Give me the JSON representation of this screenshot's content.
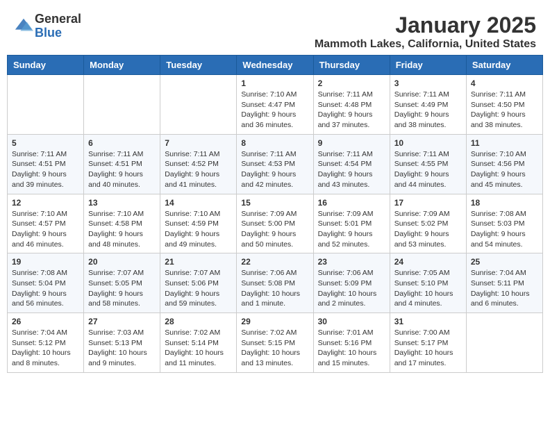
{
  "header": {
    "logo_general": "General",
    "logo_blue": "Blue",
    "month_title": "January 2025",
    "location": "Mammoth Lakes, California, United States"
  },
  "days_of_week": [
    "Sunday",
    "Monday",
    "Tuesday",
    "Wednesday",
    "Thursday",
    "Friday",
    "Saturday"
  ],
  "weeks": [
    [
      {
        "day": "",
        "content": ""
      },
      {
        "day": "",
        "content": ""
      },
      {
        "day": "",
        "content": ""
      },
      {
        "day": "1",
        "content": "Sunrise: 7:10 AM\nSunset: 4:47 PM\nDaylight: 9 hours and 36 minutes."
      },
      {
        "day": "2",
        "content": "Sunrise: 7:11 AM\nSunset: 4:48 PM\nDaylight: 9 hours and 37 minutes."
      },
      {
        "day": "3",
        "content": "Sunrise: 7:11 AM\nSunset: 4:49 PM\nDaylight: 9 hours and 38 minutes."
      },
      {
        "day": "4",
        "content": "Sunrise: 7:11 AM\nSunset: 4:50 PM\nDaylight: 9 hours and 38 minutes."
      }
    ],
    [
      {
        "day": "5",
        "content": "Sunrise: 7:11 AM\nSunset: 4:51 PM\nDaylight: 9 hours and 39 minutes."
      },
      {
        "day": "6",
        "content": "Sunrise: 7:11 AM\nSunset: 4:51 PM\nDaylight: 9 hours and 40 minutes."
      },
      {
        "day": "7",
        "content": "Sunrise: 7:11 AM\nSunset: 4:52 PM\nDaylight: 9 hours and 41 minutes."
      },
      {
        "day": "8",
        "content": "Sunrise: 7:11 AM\nSunset: 4:53 PM\nDaylight: 9 hours and 42 minutes."
      },
      {
        "day": "9",
        "content": "Sunrise: 7:11 AM\nSunset: 4:54 PM\nDaylight: 9 hours and 43 minutes."
      },
      {
        "day": "10",
        "content": "Sunrise: 7:11 AM\nSunset: 4:55 PM\nDaylight: 9 hours and 44 minutes."
      },
      {
        "day": "11",
        "content": "Sunrise: 7:10 AM\nSunset: 4:56 PM\nDaylight: 9 hours and 45 minutes."
      }
    ],
    [
      {
        "day": "12",
        "content": "Sunrise: 7:10 AM\nSunset: 4:57 PM\nDaylight: 9 hours and 46 minutes."
      },
      {
        "day": "13",
        "content": "Sunrise: 7:10 AM\nSunset: 4:58 PM\nDaylight: 9 hours and 48 minutes."
      },
      {
        "day": "14",
        "content": "Sunrise: 7:10 AM\nSunset: 4:59 PM\nDaylight: 9 hours and 49 minutes."
      },
      {
        "day": "15",
        "content": "Sunrise: 7:09 AM\nSunset: 5:00 PM\nDaylight: 9 hours and 50 minutes."
      },
      {
        "day": "16",
        "content": "Sunrise: 7:09 AM\nSunset: 5:01 PM\nDaylight: 9 hours and 52 minutes."
      },
      {
        "day": "17",
        "content": "Sunrise: 7:09 AM\nSunset: 5:02 PM\nDaylight: 9 hours and 53 minutes."
      },
      {
        "day": "18",
        "content": "Sunrise: 7:08 AM\nSunset: 5:03 PM\nDaylight: 9 hours and 54 minutes."
      }
    ],
    [
      {
        "day": "19",
        "content": "Sunrise: 7:08 AM\nSunset: 5:04 PM\nDaylight: 9 hours and 56 minutes."
      },
      {
        "day": "20",
        "content": "Sunrise: 7:07 AM\nSunset: 5:05 PM\nDaylight: 9 hours and 58 minutes."
      },
      {
        "day": "21",
        "content": "Sunrise: 7:07 AM\nSunset: 5:06 PM\nDaylight: 9 hours and 59 minutes."
      },
      {
        "day": "22",
        "content": "Sunrise: 7:06 AM\nSunset: 5:08 PM\nDaylight: 10 hours and 1 minute."
      },
      {
        "day": "23",
        "content": "Sunrise: 7:06 AM\nSunset: 5:09 PM\nDaylight: 10 hours and 2 minutes."
      },
      {
        "day": "24",
        "content": "Sunrise: 7:05 AM\nSunset: 5:10 PM\nDaylight: 10 hours and 4 minutes."
      },
      {
        "day": "25",
        "content": "Sunrise: 7:04 AM\nSunset: 5:11 PM\nDaylight: 10 hours and 6 minutes."
      }
    ],
    [
      {
        "day": "26",
        "content": "Sunrise: 7:04 AM\nSunset: 5:12 PM\nDaylight: 10 hours and 8 minutes."
      },
      {
        "day": "27",
        "content": "Sunrise: 7:03 AM\nSunset: 5:13 PM\nDaylight: 10 hours and 9 minutes."
      },
      {
        "day": "28",
        "content": "Sunrise: 7:02 AM\nSunset: 5:14 PM\nDaylight: 10 hours and 11 minutes."
      },
      {
        "day": "29",
        "content": "Sunrise: 7:02 AM\nSunset: 5:15 PM\nDaylight: 10 hours and 13 minutes."
      },
      {
        "day": "30",
        "content": "Sunrise: 7:01 AM\nSunset: 5:16 PM\nDaylight: 10 hours and 15 minutes."
      },
      {
        "day": "31",
        "content": "Sunrise: 7:00 AM\nSunset: 5:17 PM\nDaylight: 10 hours and 17 minutes."
      },
      {
        "day": "",
        "content": ""
      }
    ]
  ]
}
